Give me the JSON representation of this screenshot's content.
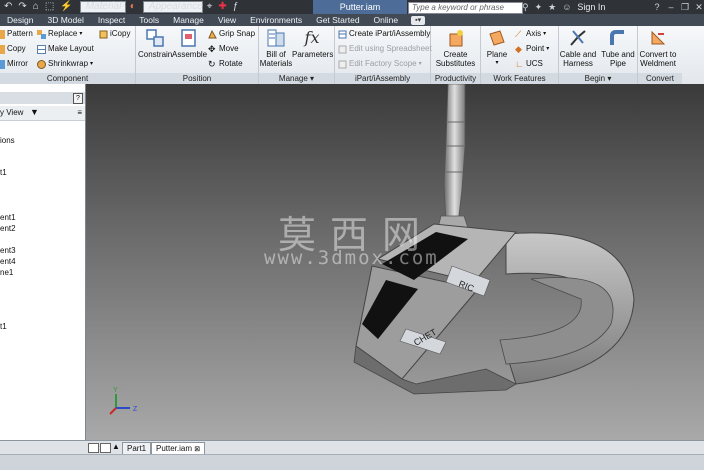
{
  "window": {
    "document_tab": "Putter.iam",
    "search_placeholder": "Type a keyword or phrase",
    "sign_in": "Sign In"
  },
  "qat": {
    "material_placeholder": "Material",
    "appearance_placeholder": "Appearance"
  },
  "menu_tabs": [
    "Design",
    "3D Model",
    "Inspect",
    "Tools",
    "Manage",
    "View",
    "Environments",
    "Get Started",
    "Online"
  ],
  "ribbon": {
    "component": {
      "title": "Component",
      "pattern": "Pattern",
      "copy": "Copy",
      "mirror": "Mirror",
      "replace": "Replace",
      "make_layout": "Make Layout",
      "shrinkwrap": "Shrinkwrap",
      "icopy": "iCopy"
    },
    "position": {
      "title": "Position",
      "constrain": "Constrain",
      "assemble": "Assemble",
      "grip_snap": "Grip Snap",
      "move": "Move",
      "rotate": "Rotate"
    },
    "manage": {
      "title": "Manage",
      "bill_of_materials_1": "Bill of",
      "bill_of_materials_2": "Materials",
      "parameters": "Parameters"
    },
    "ipart": {
      "title": "iPart/iAssembly",
      "create": "Create iPart/iAssembly",
      "edit_spreadsheet": "Edit using Spreadsheet",
      "edit_factory": "Edit Factory Scope"
    },
    "productivity": {
      "title": "Productivity",
      "create_1": "Create",
      "create_2": "Substitutes"
    },
    "work_features": {
      "title": "Work Features",
      "plane": "Plane",
      "axis": "Axis",
      "point": "Point",
      "ucs": "UCS"
    },
    "begin": {
      "title": "Begin",
      "cable_1": "Cable and",
      "cable_2": "Harness",
      "tube_1": "Tube and",
      "tube_2": "Pipe"
    },
    "convert": {
      "title": "Convert",
      "weld_1": "Convert to",
      "weld_2": "Weldment"
    }
  },
  "browser": {
    "view_label": "y View",
    "items": [
      "ions",
      "t1",
      "ent1",
      "ent2",
      "ent3",
      "ent4",
      "ne1",
      "t1"
    ]
  },
  "viewport": {
    "watermark_cn": "莫西网",
    "watermark_url": "www.3dmox.com",
    "engraving_1": "RIC",
    "engraving_2": "CHET",
    "axis_y": "Y",
    "axis_z": "Z"
  },
  "doc_tabs": [
    "Part1",
    "Putter.iam"
  ],
  "colors": {
    "ribbon_title_bg": "#d4dae1",
    "doc_tab": "#4d6d98",
    "menubar": "#414a55"
  }
}
